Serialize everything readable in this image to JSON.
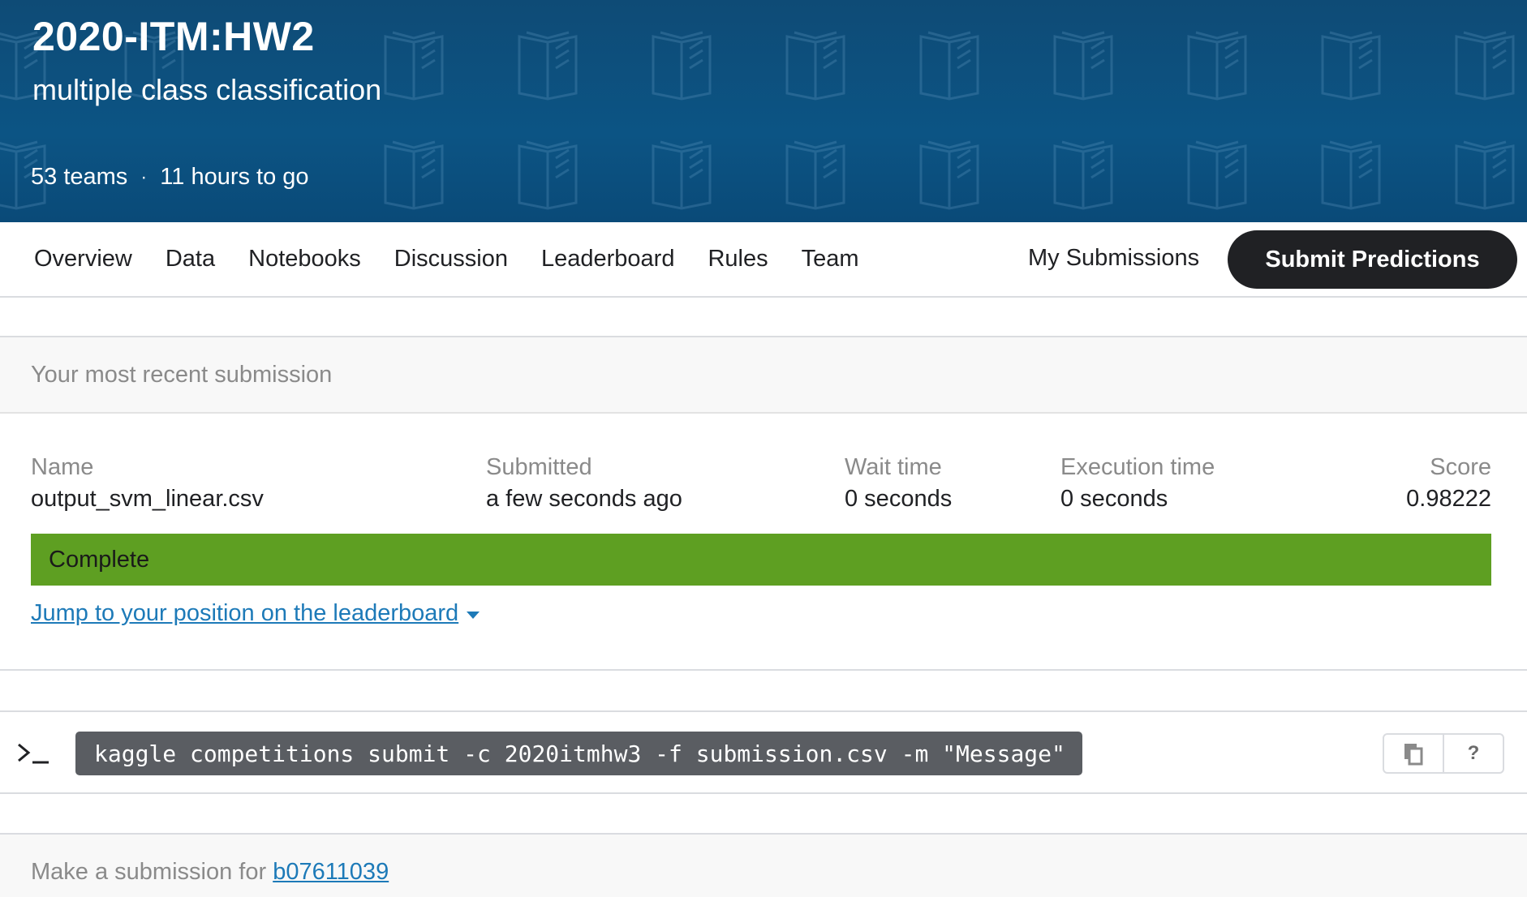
{
  "header": {
    "title": "2020-ITM:HW2",
    "subtitle": "multiple class classification",
    "teams": "53 teams",
    "separator": "·",
    "time_left": "11 hours to go"
  },
  "nav": {
    "tabs": [
      "Overview",
      "Data",
      "Notebooks",
      "Discussion",
      "Leaderboard",
      "Rules",
      "Team"
    ],
    "my_submissions": "My Submissions",
    "submit_button": "Submit Predictions"
  },
  "recent": {
    "header": "Your most recent submission",
    "columns": {
      "name": {
        "label": "Name",
        "value": "output_svm_linear.csv"
      },
      "submitted": {
        "label": "Submitted",
        "value": "a few seconds ago"
      },
      "wait": {
        "label": "Wait time",
        "value": "0 seconds"
      },
      "exec": {
        "label": "Execution time",
        "value": "0 seconds"
      },
      "score": {
        "label": "Score",
        "value": "0.98222"
      }
    },
    "status": "Complete",
    "status_color": "#5e9f22",
    "jump_link": "Jump to your position on the leaderboard"
  },
  "cli": {
    "command": "kaggle competitions submit -c 2020itmhw3 -f submission.csv -m \"Message\"",
    "copy_icon": "copy-icon",
    "help_label": "?"
  },
  "make_submission": {
    "prefix": "Make a submission for",
    "user": "b07611039"
  },
  "colors": {
    "banner": "#0c5484",
    "link": "#1d7ab8",
    "button_bg": "#202124"
  }
}
